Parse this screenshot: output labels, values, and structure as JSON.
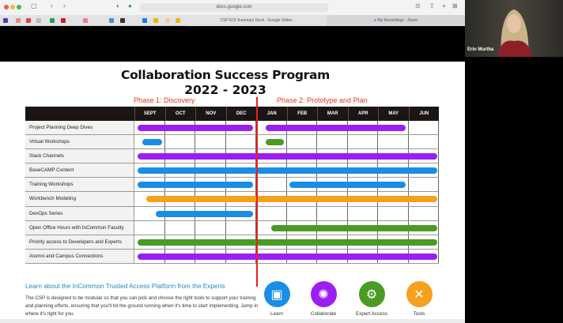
{
  "browser": {
    "url": "docs.google.com",
    "tabs": [
      {
        "label": "CSP EOI Summary Deck - Google Slides",
        "active": true
      },
      {
        "label": "My Recordings - Zoom",
        "active": false
      }
    ]
  },
  "video": {
    "participant_name": "Erin Murtha"
  },
  "slide": {
    "title": "Collaboration Success Program",
    "years": "2022 - 2023",
    "phase1": "Phase 1: Discovery",
    "phase2": "Phase 2: Prototype and Plan",
    "months": [
      "SEPT",
      "OCT",
      "NOV",
      "DEC",
      "JAN",
      "FEB",
      "MAR",
      "APR",
      "MAY",
      "JUN"
    ],
    "colors": {
      "purple": "#9a1ff0",
      "blue": "#1a8ee6",
      "green": "#4a9a24",
      "orange": "#f7a01e",
      "phase_red": "#e5231b"
    },
    "rows": [
      {
        "label": "Project Planning Deep Dives",
        "bars": [
          {
            "start": 0.1,
            "end": 3.9,
            "color": "purple"
          },
          {
            "start": 4.3,
            "end": 8.9,
            "color": "purple"
          }
        ]
      },
      {
        "label": "Virtual Workshops",
        "bars": [
          {
            "start": 0.25,
            "end": 0.9,
            "color": "blue"
          },
          {
            "start": 4.3,
            "end": 4.9,
            "color": "green"
          }
        ]
      },
      {
        "label": "Slack Channels",
        "bars": [
          {
            "start": 0.1,
            "end": 9.95,
            "color": "purple"
          }
        ]
      },
      {
        "label": "BaseCAMP Content",
        "bars": [
          {
            "start": 0.1,
            "end": 9.95,
            "color": "blue"
          }
        ]
      },
      {
        "label": "Training Workshops",
        "bars": [
          {
            "start": 0.1,
            "end": 3.9,
            "color": "blue"
          },
          {
            "start": 5.1,
            "end": 8.9,
            "color": "blue"
          }
        ]
      },
      {
        "label": "Workbench Modeling",
        "bars": [
          {
            "start": 0.4,
            "end": 9.95,
            "color": "orange"
          }
        ]
      },
      {
        "label": "DevOps Series",
        "bars": [
          {
            "start": 0.7,
            "end": 3.9,
            "color": "blue"
          }
        ]
      },
      {
        "label": "Open Office Hours with InCommon Faculty",
        "bars": [
          {
            "start": 4.5,
            "end": 9.95,
            "color": "green"
          }
        ]
      },
      {
        "label": "Priority access to Developers and Experts",
        "bars": [
          {
            "start": 0.1,
            "end": 9.95,
            "color": "green"
          }
        ]
      },
      {
        "label": "Alumni and Campus Connections",
        "bars": [
          {
            "start": 0.1,
            "end": 9.95,
            "color": "purple"
          }
        ]
      }
    ],
    "learn_heading": "Learn about the InCommon Trusted Access Platform from the Experts",
    "learn_body": "The CSP is designed to be modular so that you can pick and choose the right tools to support your training and planning efforts, ensuring that you'll hit the ground running when it's time to start implementing. Jump in where it's right for you.",
    "features": [
      {
        "label": "Learn",
        "icon": "presentation-icon",
        "color": "#1a8ee6"
      },
      {
        "label": "Collaborate",
        "icon": "network-icon",
        "color": "#9a1ff0"
      },
      {
        "label": "Expert Access",
        "icon": "head-gears-icon",
        "color": "#4a9a24"
      },
      {
        "label": "Tools",
        "icon": "wrench-screwdriver-icon",
        "color": "#f7a01e"
      }
    ]
  }
}
